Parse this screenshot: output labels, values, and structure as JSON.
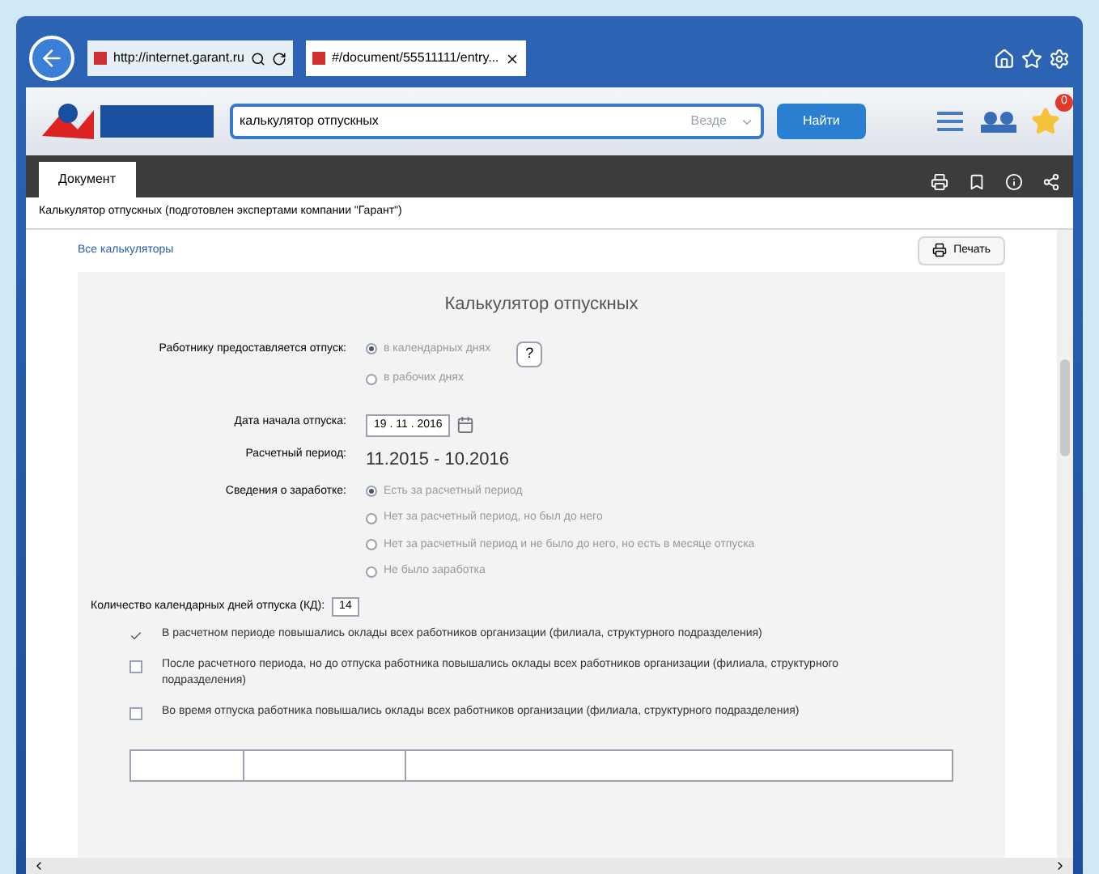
{
  "browser": {
    "tabs": [
      {
        "label": "http://internet.garant.ru",
        "selected": false
      },
      {
        "label": "#/document/55511111/entry...",
        "selected": true
      }
    ]
  },
  "header": {
    "search_value": "калькулятор отпускных",
    "scope": "Везде",
    "search_button": "Найти",
    "notification_count": "0"
  },
  "doc_tabs": [
    {
      "label": "Документ",
      "selected": true
    }
  ],
  "doc_title": "Калькулятор отпускных (подготовлен экспертами компании \"Гарант\")",
  "all_link": "Все калькуляторы",
  "print_button": "Печать",
  "calc": {
    "title": "Калькулятор отпускных",
    "leave_label": "Работнику предоставляется отпуск:",
    "help": "?",
    "leave_options": [
      {
        "label": "в календарных днях",
        "selected": true
      },
      {
        "label": "в рабочих днях",
        "selected": false
      }
    ],
    "start_label": "Дата начала отпуска:",
    "start_value": "19 . 11 . 2016",
    "period_label": "Расчетный период:",
    "period_value": "11.2015 - 10.2016",
    "earnings_label": "Сведения о заработке:",
    "earnings_options": [
      {
        "label": "Есть за расчетный период",
        "selected": true
      },
      {
        "label": "Нет за расчетный период, но был до него",
        "selected": false
      },
      {
        "label": "Нет за расчетный период и не было до него, но есть в месяце отпуска",
        "selected": false
      },
      {
        "label": "Не было заработка",
        "selected": false
      }
    ],
    "days_label": "Количество календарных дней отпуска (КД):",
    "days_value": "14",
    "raises": [
      {
        "label": "В расчетном периоде повышались оклады всех работников организации (филиала, структурного подразделения)",
        "checked": true
      },
      {
        "label": "После расчетного периода, но до отпуска работника повышались оклады всех работников организации (филиала, структурного подразделения)",
        "checked": false
      },
      {
        "label": "Во время отпуска работника повышались оклады всех работников организации (филиала, структурного подразделения)",
        "checked": false
      }
    ]
  }
}
